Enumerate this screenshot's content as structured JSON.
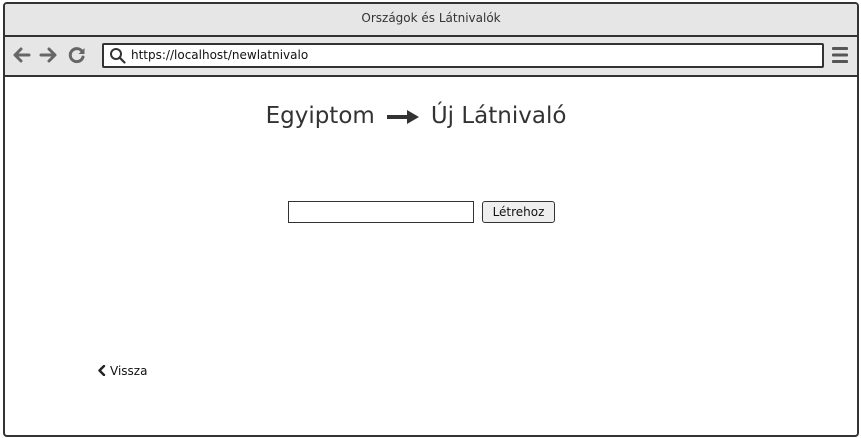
{
  "window": {
    "title": "Országok és Látnivalók"
  },
  "toolbar": {
    "url": "https://localhost/newlatnivalo"
  },
  "page": {
    "heading_country": "Egyiptom",
    "heading_page": "Új Látnivaló",
    "input_value": "",
    "create_label": "Létrehoz",
    "back_label": "Vissza"
  },
  "icons": {
    "back": "arrow-left-icon",
    "forward": "arrow-right-icon",
    "reload": "reload-icon",
    "search": "search-icon",
    "menu": "hamburger-menu-icon",
    "heading_arrow": "long-arrow-right-icon",
    "back_link": "chevron-left-icon"
  },
  "colors": {
    "chrome": "#e6e6e6",
    "border": "#333333"
  }
}
